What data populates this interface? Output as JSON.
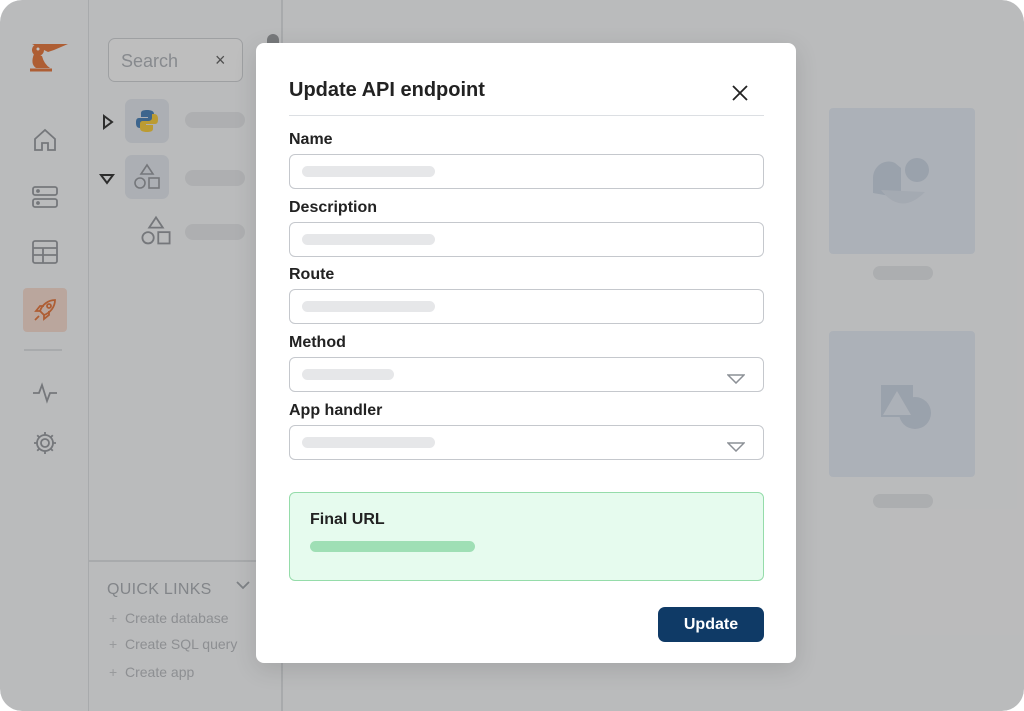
{
  "sidebar": {
    "search": {
      "placeholder": "Search",
      "clear": "×"
    },
    "quick_links": {
      "title": "QUICK LINKS",
      "items": [
        "Create database",
        "Create SQL query",
        "Create app"
      ]
    }
  },
  "icons": {
    "rail": [
      "home-icon",
      "servers-icon",
      "table-icon",
      "rocket-icon",
      "activity-icon",
      "gear-icon"
    ],
    "tree": [
      "python-icon",
      "shapes-icon",
      "shapes-icon"
    ]
  },
  "colors": {
    "accent": "#e26a2c",
    "primary_button": "#0f3a66",
    "success_bg": "#e6fbee",
    "success_border": "#95dcaa"
  },
  "modal": {
    "title": "Update API endpoint",
    "fields": [
      {
        "label": "Name"
      },
      {
        "label": "Description"
      },
      {
        "label": "Route"
      },
      {
        "label": "Method"
      },
      {
        "label": "App handler"
      }
    ],
    "final_url": {
      "label": "Final URL"
    },
    "submit_label": "Update"
  }
}
